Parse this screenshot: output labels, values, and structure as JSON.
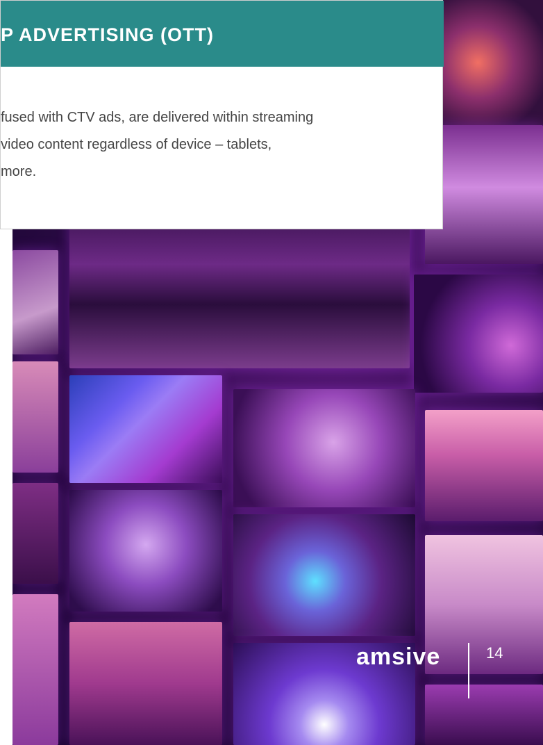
{
  "card": {
    "title": "P ADVERTISING (OTT)",
    "lines": [
      "fused with CTV ads, are delivered within streaming",
      "video content regardless of device – tablets,",
      "more."
    ]
  },
  "footer": {
    "brand": "amsive",
    "page_number": "14"
  },
  "colors": {
    "header_teal": "#2a8b8a",
    "text_gray": "#444444"
  }
}
